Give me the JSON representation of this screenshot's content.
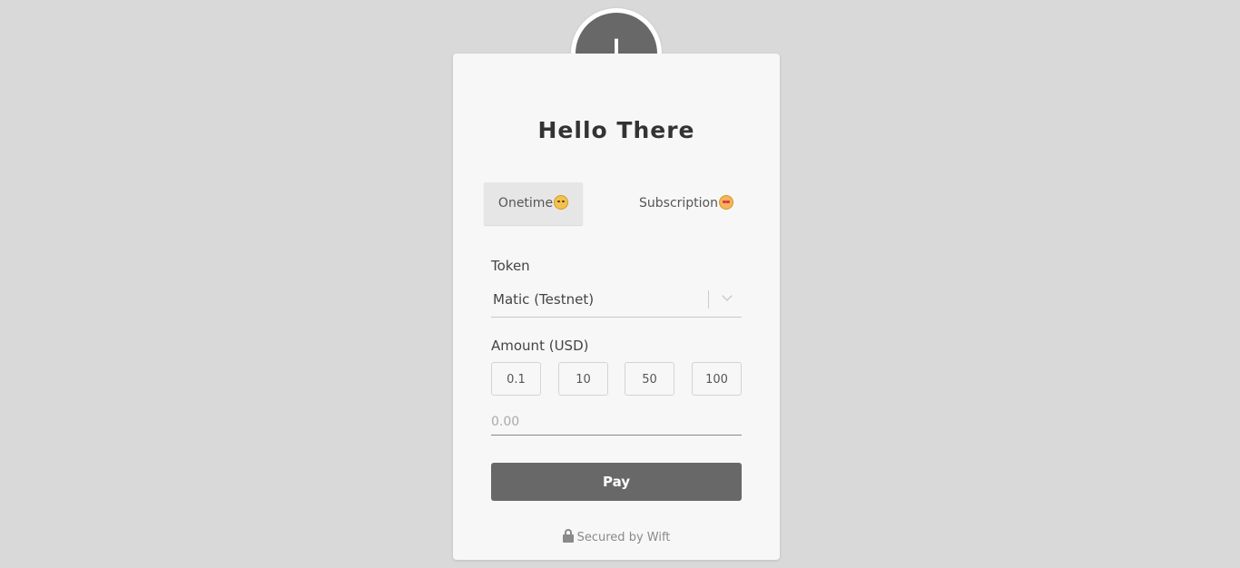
{
  "avatar": {
    "initial": "I"
  },
  "title": "Hello There",
  "tabs": [
    {
      "label": "Onetime",
      "icon": "smiling-face-with-halo-icon",
      "active": true
    },
    {
      "label": "Subscription",
      "icon": "star-struck-face-icon",
      "active": false
    }
  ],
  "token": {
    "label": "Token",
    "selected": "Matic (Testnet)"
  },
  "amount": {
    "label": "Amount (USD)",
    "presets": [
      "0.1",
      "10",
      "50",
      "100"
    ],
    "placeholder": "0.00",
    "value": ""
  },
  "pay_label": "Pay",
  "footer": {
    "text": "Secured by Wift",
    "icon": "lock-icon"
  },
  "colors": {
    "background": "#d9d9d9",
    "card": "#f7f7f7",
    "accent": "#686868",
    "active_tab": "#e6e6e6"
  }
}
